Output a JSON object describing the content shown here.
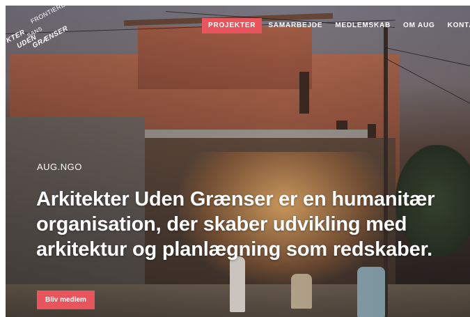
{
  "logo": {
    "line1": "KTER",
    "line2": "SANS",
    "line3": "FRONTIERES",
    "line4": "UDEN",
    "line5": "GRÆNSER"
  },
  "nav": {
    "items": [
      "PROJEKTER",
      "SAMARBEJDE",
      "MEDLEMSKAB",
      "OM AUG",
      "KONTAKT"
    ],
    "active_index": 0
  },
  "hero": {
    "kicker": "AUG.NGO",
    "headline": "Arkitekter Uden Grænser er en humanitær organisation, der skaber udvikling med arkitektur og planlægning som redskaber.",
    "cta_label": "Bliv medlem"
  },
  "colors": {
    "accent": "#e9555d",
    "text": "#ffffff"
  }
}
